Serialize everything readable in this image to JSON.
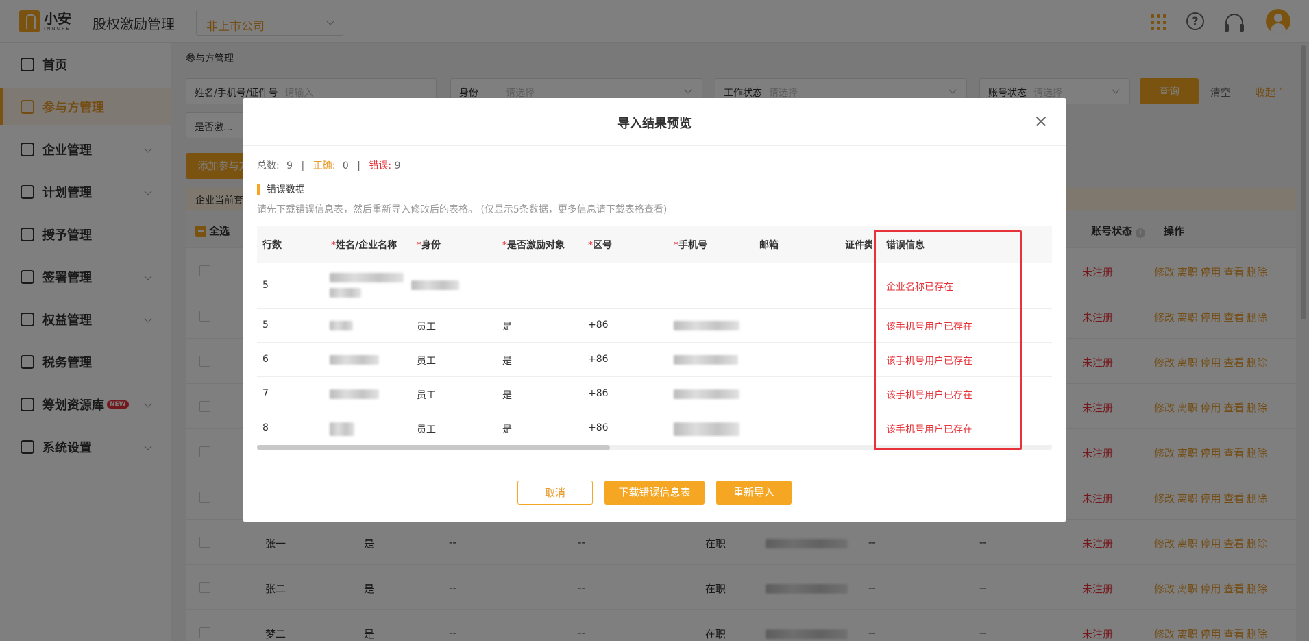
{
  "header": {
    "logo_name": "小安",
    "logo_sub": "INNOPE",
    "app_title": "股权激励管理",
    "company_select": "非上市公司"
  },
  "sidebar": {
    "items": [
      {
        "label": "首页",
        "icon": "home-icon"
      },
      {
        "label": "参与方管理",
        "icon": "users-icon",
        "active": true
      },
      {
        "label": "企业管理",
        "icon": "enterprise-icon"
      },
      {
        "label": "计划管理",
        "icon": "plan-icon"
      },
      {
        "label": "授予管理",
        "icon": "grant-icon"
      },
      {
        "label": "签署管理",
        "icon": "sign-icon"
      },
      {
        "label": "权益管理",
        "icon": "equity-icon"
      },
      {
        "label": "税务管理",
        "icon": "tax-icon"
      },
      {
        "label": "筹划资源库",
        "icon": "layers-icon",
        "badge": "NEW"
      },
      {
        "label": "系统设置",
        "icon": "settings-icon"
      }
    ]
  },
  "main": {
    "breadcrumb": "参与方管理",
    "filters": {
      "name_label": "姓名/手机号/证件号",
      "name_placeholder": "请输入",
      "identity_label": "身份",
      "identity_placeholder": "请选择",
      "work_status_label": "工作状态",
      "work_status_placeholder": "请选择",
      "account_status_label": "账号状态",
      "account_status_placeholder": "请选择",
      "incentive_label": "是否激..."
    },
    "query_button": "查询",
    "clear_button": "清空",
    "collapse_button": "收起",
    "add_button": "添加参与方",
    "notice_text": "企业当前套",
    "table": {
      "select_all": "全选",
      "col_account_status": "账号状态",
      "col_ops": "操作",
      "status_unregistered": "未注册",
      "ops": "修改 离职 停用 查看 删除",
      "rows": [
        {
          "name": "",
          "incentive": "",
          "identity": "",
          "work": ""
        },
        {
          "name": "",
          "incentive": "",
          "identity": "",
          "work": ""
        },
        {
          "name": "",
          "incentive": "",
          "identity": "",
          "work": ""
        },
        {
          "name": "",
          "incentive": "",
          "identity": "",
          "work": ""
        },
        {
          "name": "",
          "incentive": "",
          "identity": "",
          "work": ""
        },
        {
          "name": "",
          "incentive": "",
          "identity": "",
          "work": ""
        },
        {
          "name": "张一",
          "incentive": "是",
          "c1": "--",
          "c2": "--",
          "work": "在职",
          "c3": "--",
          "c4": "--"
        },
        {
          "name": "张二",
          "incentive": "是",
          "c1": "--",
          "c2": "--",
          "work": "在职",
          "c3": "--",
          "c4": "--"
        },
        {
          "name": "梦二",
          "incentive": "是",
          "c1": "--",
          "c2": "--",
          "work": "在职",
          "c3": "--",
          "c4": "--"
        }
      ]
    }
  },
  "modal": {
    "title": "导入结果预览",
    "summary_total_label": "总数:",
    "summary_total": "9",
    "summary_ok_label": "正确:",
    "summary_ok": "0",
    "summary_err_label": "错误:",
    "summary_err": "9",
    "section_title": "错误数据",
    "section_desc": "请先下载错误信息表，然后重新导入修改后的表格。   (仅显示5条数据，更多信息请下载表格查看)",
    "columns": [
      "行数",
      "姓名/企业名称",
      "身份",
      "是否激励对象",
      "区号",
      "手机号",
      "邮箱",
      "证件类",
      "错误信息"
    ],
    "rows": [
      {
        "line": "5",
        "identity": "",
        "incentive": "",
        "area": "",
        "error": "企业名称已存在"
      },
      {
        "line": "5",
        "identity": "员工",
        "incentive": "是",
        "area": "+86",
        "error": "该手机号用户已存在"
      },
      {
        "line": "6",
        "identity": "员工",
        "incentive": "是",
        "area": "+86",
        "error": "该手机号用户已存在"
      },
      {
        "line": "7",
        "identity": "员工",
        "incentive": "是",
        "area": "+86",
        "error": "该手机号用户已存在"
      },
      {
        "line": "8",
        "identity": "员工",
        "incentive": "是",
        "area": "+86",
        "error": "该手机号用户已存在"
      }
    ],
    "cancel_button": "取消",
    "download_button": "下载错误信息表",
    "reimport_button": "重新导入"
  },
  "colors": {
    "accent": "#f5a623",
    "error": "#e6333a"
  }
}
